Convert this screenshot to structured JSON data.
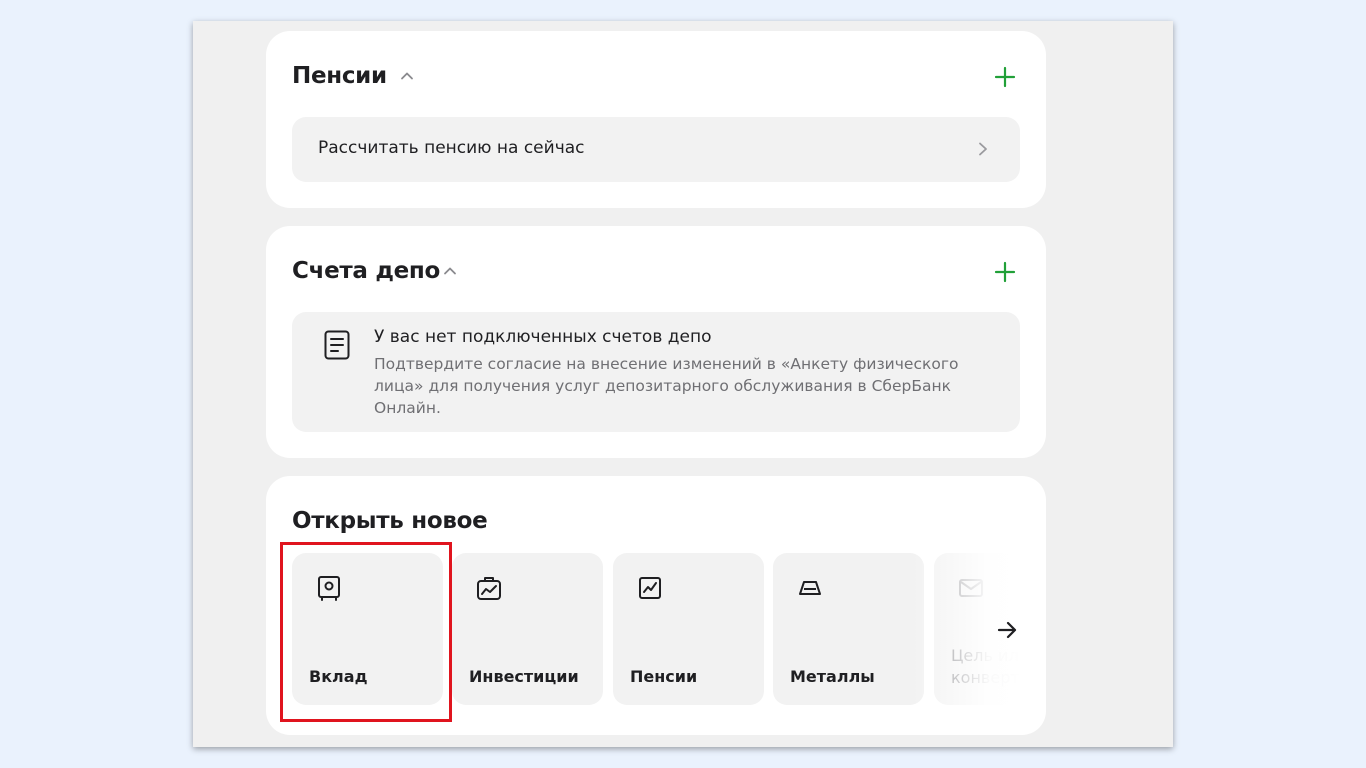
{
  "pensions": {
    "title": "Пенсии",
    "row_label": "Рассчитать пенсию на сейчас"
  },
  "depo": {
    "title": "Счета депо",
    "info_title": "У вас нет подключенных счетов депо",
    "info_desc": "Подтвердите согласие на внесение изменений в «Анкету физического лица» для получения услуг депозитарного обслуживания в СберБанк Онлайн."
  },
  "open_new": {
    "title": "Открыть новое",
    "tiles": [
      {
        "label": "Вклад",
        "icon": "safe-icon"
      },
      {
        "label": "Инвестиции",
        "icon": "briefcase-chart-icon"
      },
      {
        "label": "Пенсии",
        "icon": "chart-icon"
      },
      {
        "label": "Металлы",
        "icon": "gold-bar-icon"
      },
      {
        "label": "Цель или конверт",
        "icon": "envelope-icon"
      }
    ]
  },
  "colors": {
    "accent_green": "#21a038",
    "highlight_red": "#e0141e"
  }
}
